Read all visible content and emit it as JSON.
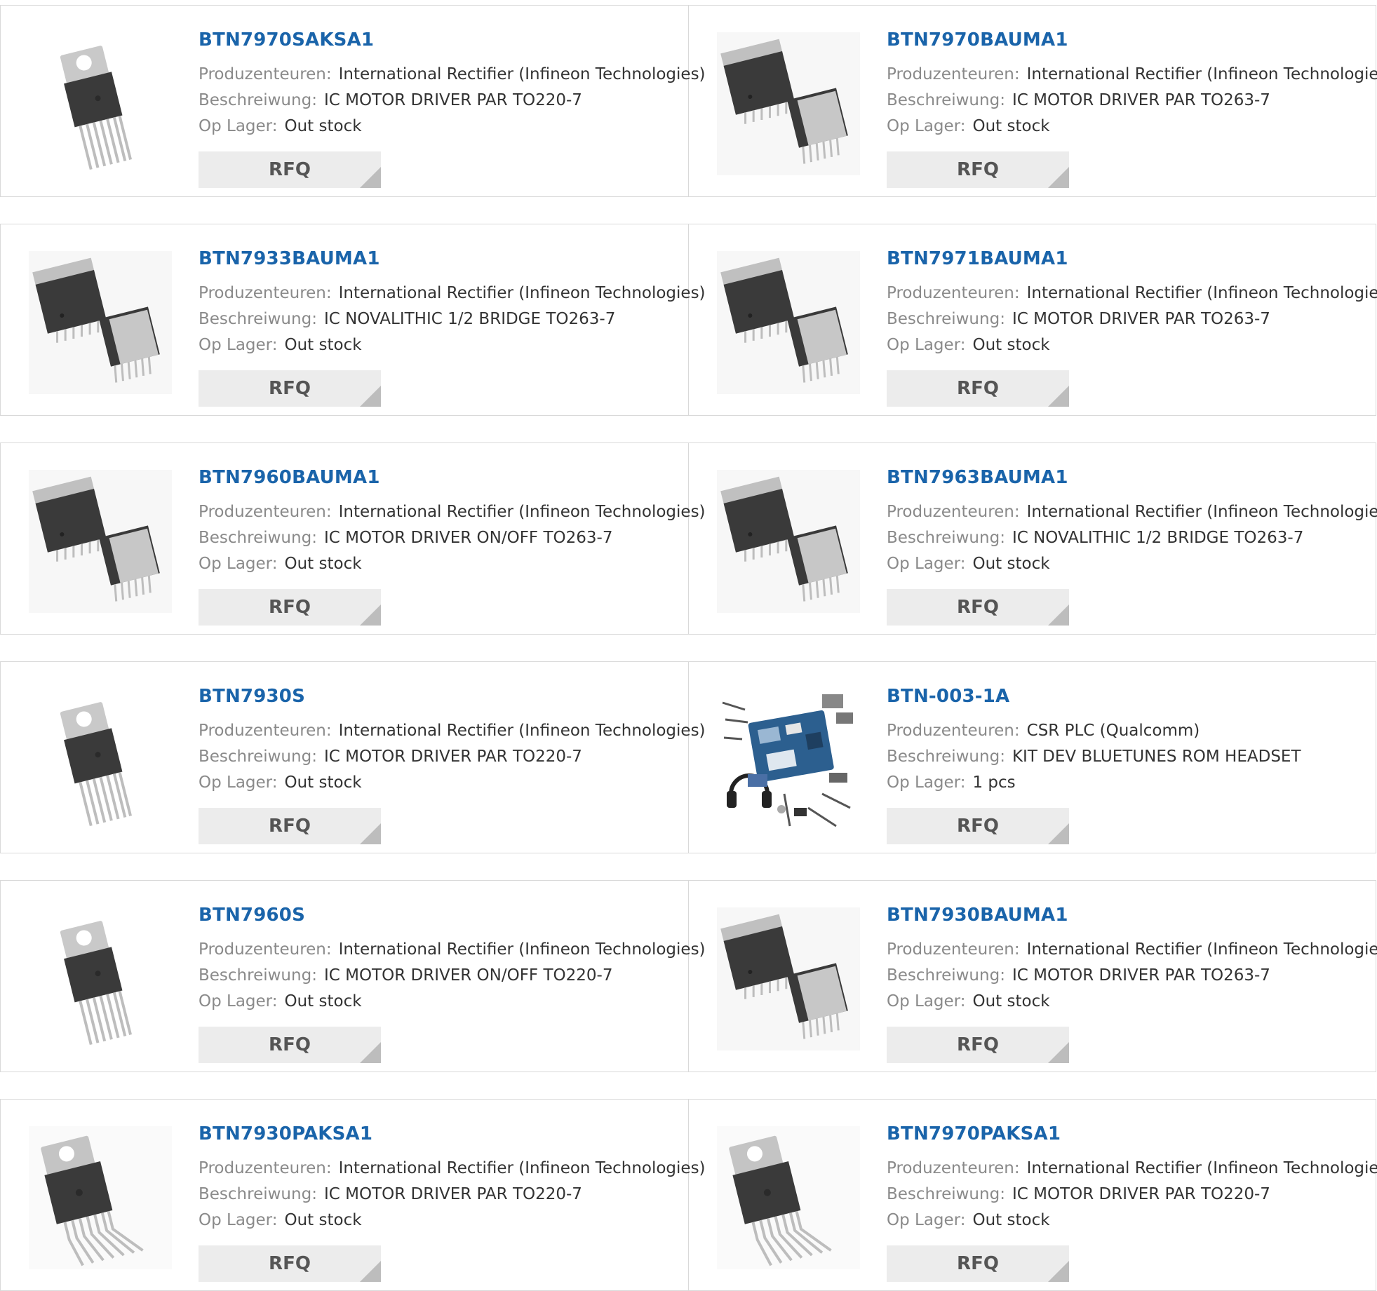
{
  "labels": {
    "manufacturer": "Produzenteuren:",
    "description": "Beschreiwung:",
    "stock": "Op Lager:",
    "rfq": "RFQ"
  },
  "rows": [
    [
      {
        "part": "BTN7970SAKSA1",
        "manufacturer": "International Rectifier (Infineon Technologies)",
        "description": "IC MOTOR DRIVER PAR TO220-7",
        "stock": "Out stock",
        "image": "to220-icon"
      },
      {
        "part": "BTN7970BAUMA1",
        "manufacturer": "International Rectifier (Infineon Technologies)",
        "description": "IC MOTOR DRIVER PAR TO263-7",
        "stock": "Out stock",
        "image": "to263-icon"
      }
    ],
    [
      {
        "part": "BTN7933BAUMA1",
        "manufacturer": "International Rectifier (Infineon Technologies)",
        "description": "IC NOVALITHIC 1/2 BRIDGE TO263-7",
        "stock": "Out stock",
        "image": "to263-icon"
      },
      {
        "part": "BTN7971BAUMA1",
        "manufacturer": "International Rectifier (Infineon Technologies)",
        "description": "IC MOTOR DRIVER PAR TO263-7",
        "stock": "Out stock",
        "image": "to263-icon"
      }
    ],
    [
      {
        "part": "BTN7960BAUMA1",
        "manufacturer": "International Rectifier (Infineon Technologies)",
        "description": "IC MOTOR DRIVER ON/OFF TO263-7",
        "stock": "Out stock",
        "image": "to263-icon"
      },
      {
        "part": "BTN7963BAUMA1",
        "manufacturer": "International Rectifier (Infineon Technologies)",
        "description": "IC NOVALITHIC 1/2 BRIDGE TO263-7",
        "stock": "Out stock",
        "image": "to263-icon"
      }
    ],
    [
      {
        "part": "BTN7930S",
        "manufacturer": "International Rectifier (Infineon Technologies)",
        "description": "IC MOTOR DRIVER PAR TO220-7",
        "stock": "Out stock",
        "image": "to220-icon"
      },
      {
        "part": "BTN-003-1A",
        "manufacturer": "CSR PLC (Qualcomm)",
        "description": "KIT DEV BLUETUNES ROM HEADSET",
        "stock": "1 pcs",
        "image": "devkit-icon"
      }
    ],
    [
      {
        "part": "BTN7960S",
        "manufacturer": "International Rectifier (Infineon Technologies)",
        "description": "IC MOTOR DRIVER ON/OFF TO220-7",
        "stock": "Out stock",
        "image": "to220-icon"
      },
      {
        "part": "BTN7930BAUMA1",
        "manufacturer": "International Rectifier (Infineon Technologies)",
        "description": "IC MOTOR DRIVER PAR TO263-7",
        "stock": "Out stock",
        "image": "to263-icon"
      }
    ],
    [
      {
        "part": "BTN7930PAKSA1",
        "manufacturer": "International Rectifier (Infineon Technologies)",
        "description": "IC MOTOR DRIVER PAR TO220-7",
        "stock": "Out stock",
        "image": "to220-bent-icon"
      },
      {
        "part": "BTN7970PAKSA1",
        "manufacturer": "International Rectifier (Infineon Technologies)",
        "description": "IC MOTOR DRIVER PAR TO220-7",
        "stock": "Out stock",
        "image": "to220-bent-icon"
      }
    ]
  ]
}
